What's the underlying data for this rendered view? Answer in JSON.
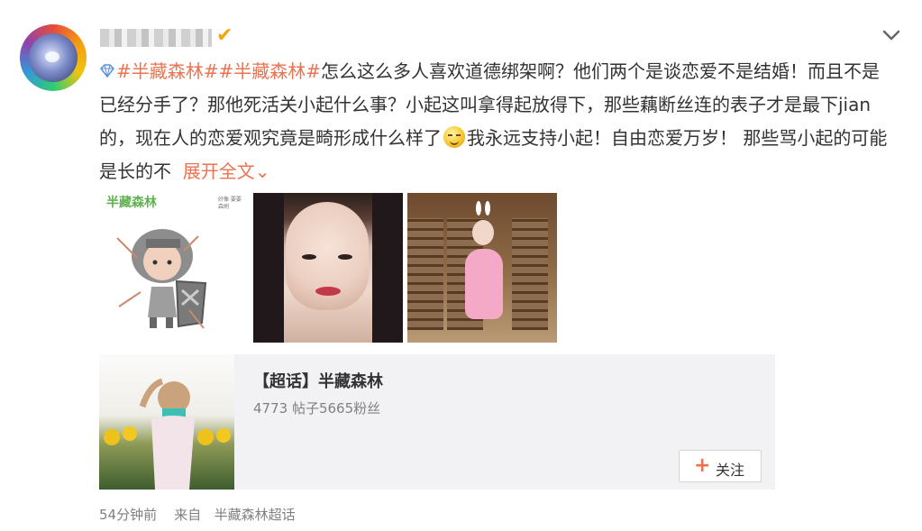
{
  "post": {
    "username_redacted": true,
    "badge_color": "#f0a800",
    "collapse_icon": "chevron-down-icon",
    "topic_icon": "diamond-icon",
    "content": {
      "topic_1": "#半藏森林#",
      "topic_2": "#半藏森林#",
      "text_1": "怎么这么多人喜欢道德绑架啊？他们两个是谈恋爱不是结婚！而且不是已经分手了？那他死活关小起什么事？小起这叫拿得起放得下，那些藕断丝连的表子才是最下jian的，现在人的恋爱观究竟是畸形成什么样了",
      "text_2": "我永远支持小起！自由恋爱万岁！ 那些骂小起的可能是长的不",
      "expand_label": "展开全文",
      "emoji_icon": "grin-sweat-emoji-icon"
    },
    "images": {
      "thumb1_label": "半藏森林",
      "thumb1_side_text": "好像 要要 森刷"
    },
    "topic_card": {
      "title": "【超话】半藏森林",
      "stats": "4773 帖子5665粉丝",
      "follow_label": "关注"
    },
    "meta": {
      "time": "54分钟前",
      "from_prefix": "来自",
      "source": "半藏森林超话"
    },
    "colors": {
      "accent": "#eb7350",
      "text": "#333333",
      "muted": "#808080",
      "card_bg": "#f2f2f5"
    }
  }
}
